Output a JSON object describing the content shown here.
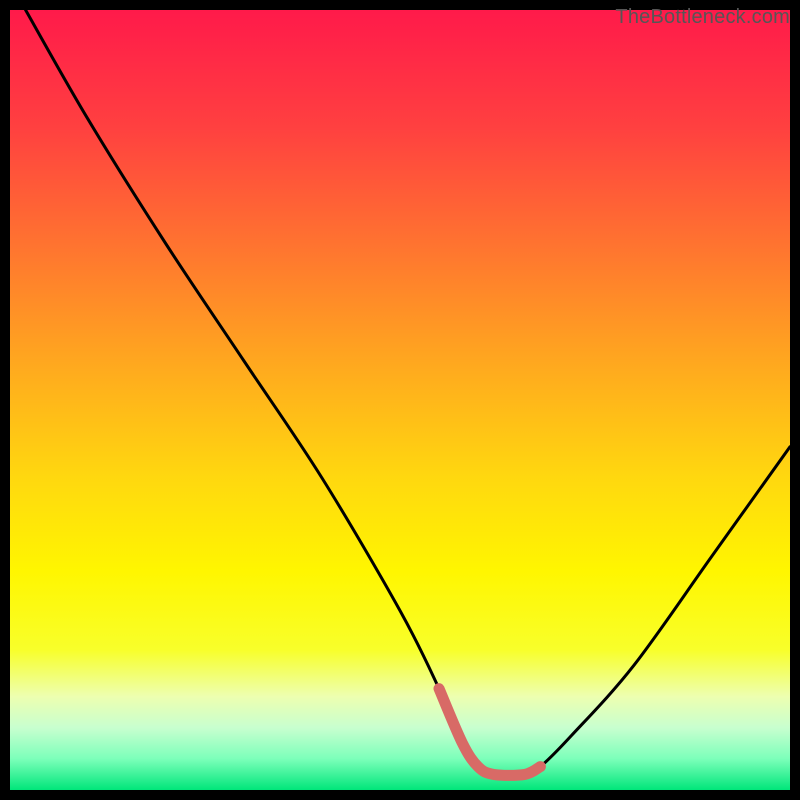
{
  "watermark": "TheBottleneck.com",
  "colors": {
    "bg_black": "#000000",
    "curve": "#000000",
    "accent_salmon": "#d86a66",
    "grad_stops": [
      {
        "offset": 0.0,
        "color": "#ff1a4a"
      },
      {
        "offset": 0.15,
        "color": "#ff4040"
      },
      {
        "offset": 0.3,
        "color": "#ff7330"
      },
      {
        "offset": 0.45,
        "color": "#ffa71f"
      },
      {
        "offset": 0.6,
        "color": "#ffd80f"
      },
      {
        "offset": 0.72,
        "color": "#fff600"
      },
      {
        "offset": 0.82,
        "color": "#f8ff2a"
      },
      {
        "offset": 0.88,
        "color": "#edffb0"
      },
      {
        "offset": 0.92,
        "color": "#c8ffcf"
      },
      {
        "offset": 0.96,
        "color": "#7cffba"
      },
      {
        "offset": 1.0,
        "color": "#00e67a"
      }
    ]
  },
  "chart_data": {
    "type": "line",
    "title": "",
    "xlabel": "",
    "ylabel": "",
    "xlim": [
      0,
      100
    ],
    "ylim": [
      0,
      100
    ],
    "grid": false,
    "legend": false,
    "series": [
      {
        "name": "bottleneck-curve",
        "x": [
          2,
          10,
          20,
          30,
          40,
          50,
          55,
          58,
          60,
          62,
          66,
          68,
          72,
          80,
          90,
          100
        ],
        "values": [
          100,
          86,
          70,
          55,
          40,
          23,
          13,
          6,
          3,
          2,
          2,
          3,
          7,
          16,
          30,
          44
        ]
      }
    ],
    "highlight_segment": {
      "name": "valley-highlight",
      "x": [
        55,
        58,
        60,
        62,
        66,
        68
      ],
      "values": [
        13,
        6,
        3,
        2,
        2,
        3
      ]
    }
  }
}
